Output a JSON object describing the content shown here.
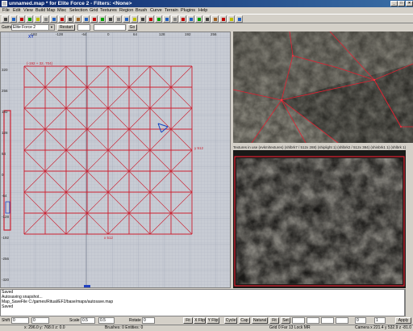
{
  "window": {
    "title": "unnamed.map * for Elite Force 2 - Filters: <None>",
    "controls": [
      "_",
      "□",
      "×"
    ]
  },
  "menu": [
    "File",
    "Edit",
    "View",
    "Build Map",
    "Misc",
    "Selection",
    "Grid",
    "Textures",
    "Region",
    "Brush",
    "Curve",
    "Terrain",
    "Plugins",
    "Help"
  ],
  "toolbar": {
    "icons": [
      "open-icon",
      "save-icon",
      "flip-x-icon",
      "flip-y-icon",
      "flip-z-icon",
      "rotate-x-icon",
      "rotate-y-icon",
      "rotate-z-icon",
      "select-complete-icon",
      "select-inside-icon",
      "select-touching-icon",
      "csg-subtract-icon",
      "csg-merge-icon",
      "hollow-icon",
      "clipper-icon",
      "view-change-icon",
      "texture-lock-icon",
      "camera-icon",
      "drag-edges-icon",
      "drag-vertices-icon",
      "scale-icon",
      "rotate-icon",
      "patch-icon",
      "bend-icon",
      "cap-icon",
      "thicken-icon",
      "terrain-icon",
      "entity-icon",
      "light-icon",
      "pointfile-icon"
    ],
    "colors": [
      "#404040",
      "#2060c0",
      "#c00000",
      "#00a000",
      "#c0c000",
      "#808080",
      "#2060c0",
      "#c00000",
      "#404040",
      "#a06020",
      "#2060c0",
      "#c00000",
      "#00a000",
      "#404040",
      "#808080",
      "#2060c0",
      "#c0c000",
      "#404040",
      "#c00000",
      "#00a000",
      "#2060c0",
      "#808080",
      "#c00000",
      "#2060c0",
      "#00a000",
      "#404040",
      "#a06020",
      "#c00000",
      "#c0c000",
      "#2060c0"
    ]
  },
  "gamebar": {
    "game_label": "Game",
    "game_value": "Elite Force 2",
    "restart_label": "Restart",
    "go_label": "Go"
  },
  "gridview": {
    "top_ruler": [
      "-192",
      "-128",
      "-64",
      "0",
      "64",
      "128",
      "192",
      "256"
    ],
    "left_ruler": [
      "320",
      "256",
      "192",
      "128",
      "64",
      "0",
      "-64",
      "-128",
      "-192",
      "-256",
      "-320"
    ],
    "xy_label": "XY",
    "corner_label": "(-192 + 32, 704)",
    "width_label": "x 512",
    "height_label": "y 512",
    "grid_cells": 8
  },
  "texture_window": {
    "header": "Textures in use   (evkm/textures)   (shlbrk7 / 512x 288)   (shiplight 1)   (shlbrk2 / 512x 384)   (shinbrk1 1)   (shlbrk 1)"
  },
  "console": {
    "lines": [
      "Saved",
      "Autosaving snapshot...",
      "Map_SaveFile C:/games/Ritual/EF2/base/maps/autosave.map",
      "Saved"
    ]
  },
  "bottombar": {
    "shift_label": "Shift",
    "shift_h": "0",
    "shift_v": "0",
    "scale_label": "Scale",
    "scale_h": "0.5",
    "scale_v": "0.5",
    "rotate_label": "Rotate",
    "rotate_value": "0",
    "fit_label": "Fit",
    "xflip_label": "X Flip",
    "yflip_label": "Y Flip",
    "cycle_label": "Cycle",
    "cap_label": "Cap",
    "natural_label": "Natural",
    "fit2_label": "Fit",
    "set_label": "Set",
    "s_value": "0",
    "t_value": "1",
    "apply_label": "Apply"
  },
  "status": {
    "coords": "x: 296.0   y: 768.0   z: 0.0",
    "counts": "Brushes: 0  Entities: 0",
    "grid": "Grid 0  Far 13  Lock MR",
    "camera": "Camera x 221.4  y 532.9  z -81.0"
  },
  "colors": {
    "grid_bg": "#c8ccd4",
    "brush_red": "#cc2030",
    "title_blue": "#0a246a"
  }
}
